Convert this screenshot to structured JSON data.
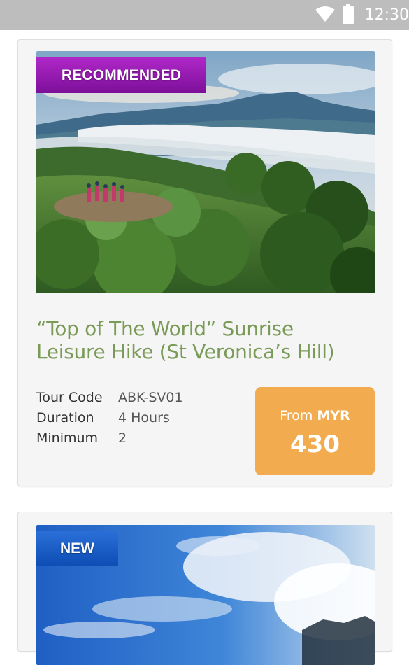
{
  "status_bar": {
    "time": "12:30",
    "icons": [
      "wifi-icon",
      "battery-icon"
    ],
    "background": "#bdbdbd"
  },
  "tours": [
    {
      "badge": "RECOMMENDED",
      "badge_color": "#9b1bb8",
      "image": "mountain-sunrise-hike-photo",
      "title_line1": "“Top of The World” Sunrise",
      "title_line2": "Leisure Hike (St Veronica’s Hill)",
      "title_color": "#7a9a57",
      "details": [
        {
          "label": "Tour Code",
          "value": "ABK-SV01"
        },
        {
          "label": "Duration",
          "value": "4 Hours"
        },
        {
          "label": "Minimum",
          "value": "2"
        }
      ],
      "price": {
        "from_label": "From",
        "currency": "MYR",
        "amount": "430",
        "color": "#f2ac4f"
      }
    },
    {
      "badge": "NEW",
      "badge_color": "#1a5fca",
      "image": "blue-sky-clouds-photo"
    }
  ]
}
